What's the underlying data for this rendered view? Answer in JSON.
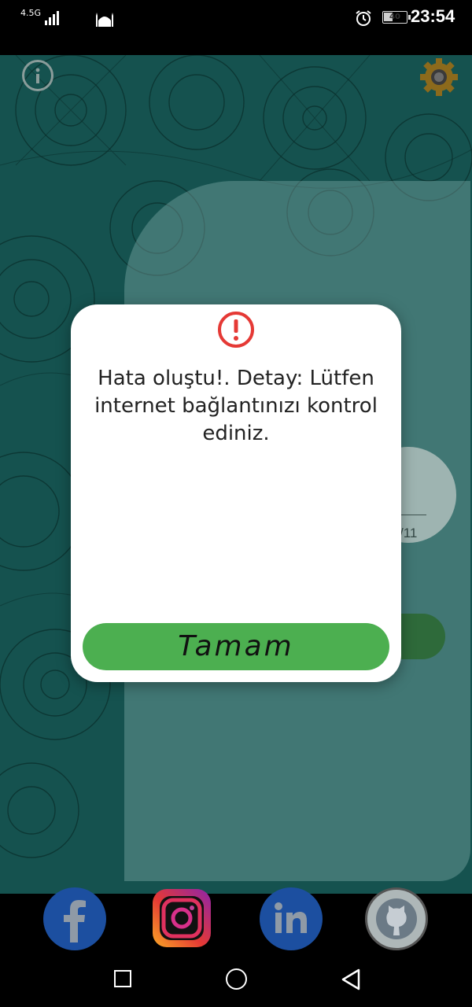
{
  "status_bar": {
    "network": "4.5G",
    "battery": "40",
    "battery_level": 0.4,
    "time": "23:54"
  },
  "background": {
    "counter": "/11"
  },
  "dialog": {
    "icon": "alert-circle-icon",
    "message": "Hata oluştu!. Detay: Lütfen internet bağlantınızı kontrol ediniz.",
    "ok_label": "Tamam"
  },
  "social_bar": {
    "items": [
      "facebook-icon",
      "instagram-icon",
      "linkedin-icon",
      "github-icon"
    ]
  },
  "nav_bar": {
    "items": [
      "recent-apps-icon",
      "home-icon",
      "back-icon"
    ]
  },
  "colors": {
    "accent_green": "#4caf50",
    "alert_red": "#e53935",
    "background_teal": "#1c6a66"
  }
}
